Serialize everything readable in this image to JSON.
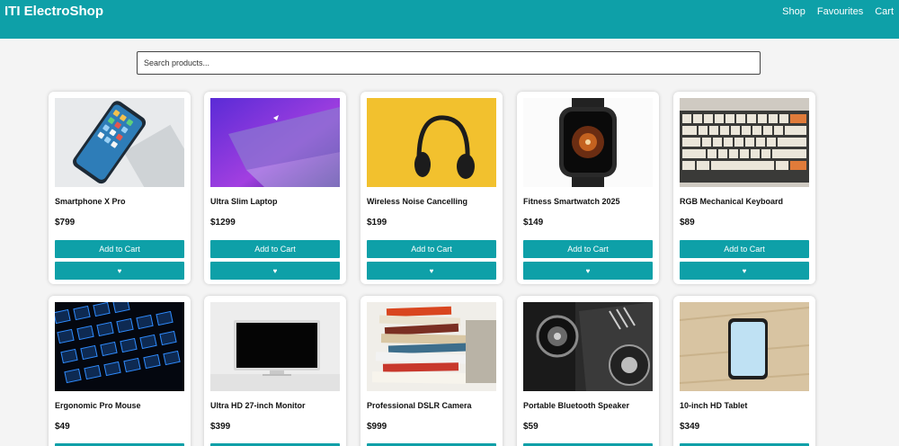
{
  "navbar": {
    "brand": "ITI ElectroShop",
    "links": [
      "Shop",
      "Favourites",
      "Cart"
    ]
  },
  "search": {
    "placeholder": "Search products...",
    "value": ""
  },
  "buttons": {
    "add_to_cart": "Add to Cart",
    "favourite": "♥"
  },
  "products": [
    {
      "name": "Smartphone X Pro",
      "price": "$799"
    },
    {
      "name": "Ultra Slim Laptop",
      "price": "$1299"
    },
    {
      "name": "Wireless Noise Cancelling",
      "price": "$199"
    },
    {
      "name": "Fitness Smartwatch 2025",
      "price": "$149"
    },
    {
      "name": "RGB Mechanical Keyboard",
      "price": "$89"
    },
    {
      "name": "Ergonomic Pro Mouse",
      "price": "$49"
    },
    {
      "name": "Ultra HD 27-inch Monitor",
      "price": "$399"
    },
    {
      "name": "Professional DSLR Camera",
      "price": "$999"
    },
    {
      "name": "Portable Bluetooth Speaker",
      "price": "$59"
    },
    {
      "name": "10-inch HD Tablet",
      "price": "$349"
    }
  ],
  "colors": {
    "accent": "#0ea0a8",
    "background": "#f4f4f4"
  }
}
